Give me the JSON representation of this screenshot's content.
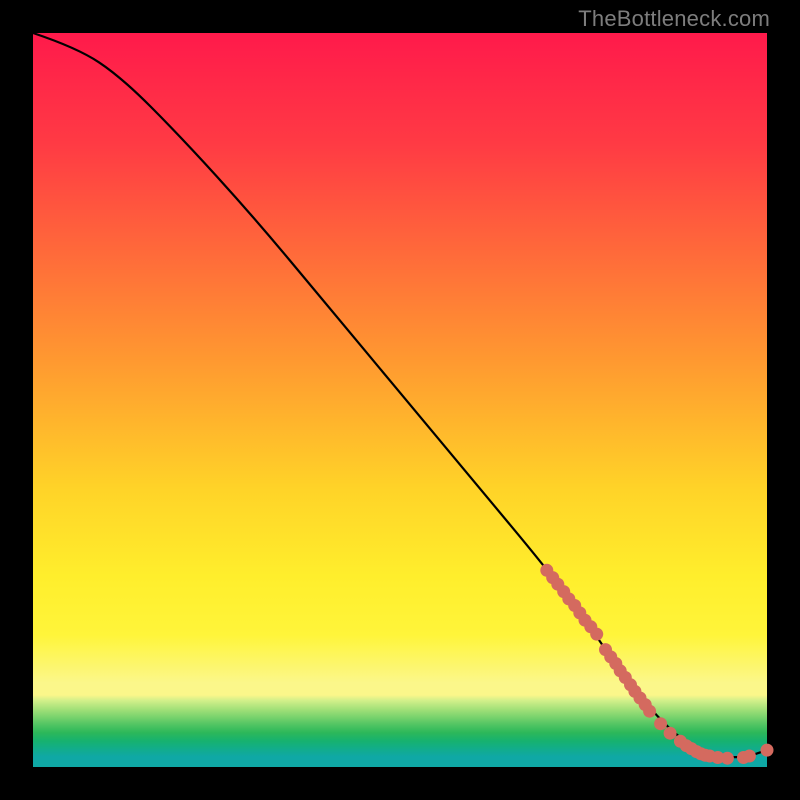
{
  "attribution": "TheBottleneck.com",
  "chart_data": {
    "type": "line",
    "title": "",
    "xlabel": "",
    "ylabel": "",
    "xlim": [
      0,
      100
    ],
    "ylim": [
      0,
      100
    ],
    "series": [
      {
        "name": "curve",
        "x": [
          0,
          6,
          12,
          20,
          30,
          40,
          50,
          60,
          70,
          76,
          80,
          84,
          88,
          91,
          94,
          97,
          100
        ],
        "y": [
          100,
          98,
          94,
          86,
          75,
          63,
          51,
          39,
          27,
          19,
          13,
          8,
          4,
          2.3,
          1.4,
          1.3,
          2.3
        ]
      }
    ],
    "markers": [
      {
        "x": 70.0,
        "y": 26.8
      },
      {
        "x": 70.8,
        "y": 25.8
      },
      {
        "x": 71.5,
        "y": 24.9
      },
      {
        "x": 72.3,
        "y": 23.9
      },
      {
        "x": 73.0,
        "y": 22.9
      },
      {
        "x": 73.8,
        "y": 22.0
      },
      {
        "x": 74.5,
        "y": 21.0
      },
      {
        "x": 75.2,
        "y": 20.0
      },
      {
        "x": 76.0,
        "y": 19.1
      },
      {
        "x": 76.8,
        "y": 18.1
      },
      {
        "x": 78.0,
        "y": 16.0
      },
      {
        "x": 78.7,
        "y": 15.0
      },
      {
        "x": 79.4,
        "y": 14.1
      },
      {
        "x": 80.0,
        "y": 13.1
      },
      {
        "x": 80.7,
        "y": 12.2
      },
      {
        "x": 81.4,
        "y": 11.2
      },
      {
        "x": 82.0,
        "y": 10.3
      },
      {
        "x": 82.7,
        "y": 9.4
      },
      {
        "x": 83.4,
        "y": 8.5
      },
      {
        "x": 84.0,
        "y": 7.6
      },
      {
        "x": 85.5,
        "y": 5.9
      },
      {
        "x": 86.8,
        "y": 4.6
      },
      {
        "x": 88.2,
        "y": 3.5
      },
      {
        "x": 89.0,
        "y": 2.9
      },
      {
        "x": 89.7,
        "y": 2.5
      },
      {
        "x": 90.4,
        "y": 2.1
      },
      {
        "x": 91.0,
        "y": 1.8
      },
      {
        "x": 91.6,
        "y": 1.6
      },
      {
        "x": 92.2,
        "y": 1.5
      },
      {
        "x": 93.3,
        "y": 1.3
      },
      {
        "x": 94.6,
        "y": 1.2
      },
      {
        "x": 96.8,
        "y": 1.3
      },
      {
        "x": 97.6,
        "y": 1.5
      },
      {
        "x": 100.0,
        "y": 2.3
      }
    ],
    "marker_color": "#d46a5f",
    "line_color": "#000000"
  }
}
